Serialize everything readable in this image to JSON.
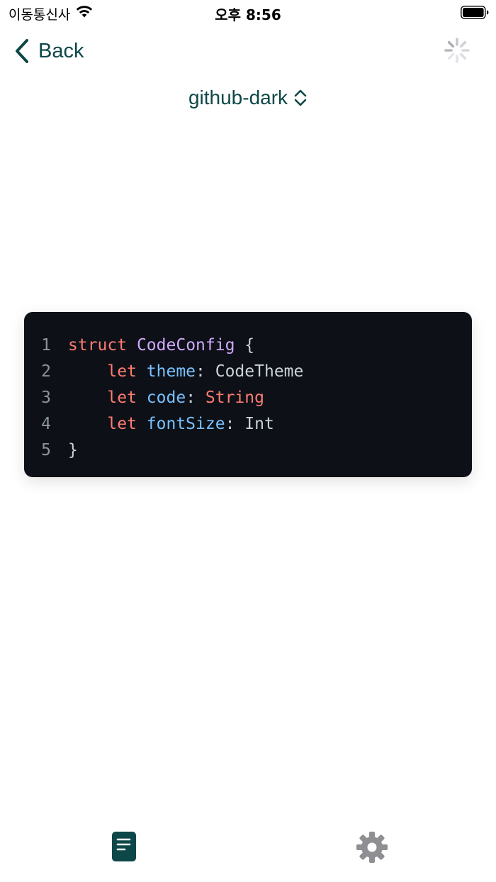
{
  "status_bar": {
    "carrier": "이동통신사",
    "time": "오후 8:56",
    "wifi_icon": "wifi-icon",
    "battery_icon": "battery-icon"
  },
  "nav": {
    "back_label": "Back",
    "back_icon": "chevron-left-icon",
    "spinner_icon": "activity-spinner-icon"
  },
  "theme_selector": {
    "label": "github-dark",
    "icon": "chevron-up-down-icon"
  },
  "code": {
    "lines": [
      {
        "number": "1",
        "tokens": [
          {
            "t": "struct",
            "k": "kw"
          },
          {
            "t": " ",
            "k": "plain"
          },
          {
            "t": "CodeConfig",
            "k": "type"
          },
          {
            "t": " {",
            "k": "plain"
          }
        ]
      },
      {
        "number": "2",
        "tokens": [
          {
            "t": "    ",
            "k": "plain"
          },
          {
            "t": "let",
            "k": "kw"
          },
          {
            "t": " ",
            "k": "plain"
          },
          {
            "t": "theme",
            "k": "prop"
          },
          {
            "t": ": CodeTheme",
            "k": "plain"
          }
        ]
      },
      {
        "number": "3",
        "tokens": [
          {
            "t": "    ",
            "k": "plain"
          },
          {
            "t": "let",
            "k": "kw"
          },
          {
            "t": " ",
            "k": "plain"
          },
          {
            "t": "code",
            "k": "prop"
          },
          {
            "t": ": ",
            "k": "plain"
          },
          {
            "t": "String",
            "k": "kw"
          }
        ]
      },
      {
        "number": "4",
        "tokens": [
          {
            "t": "    ",
            "k": "plain"
          },
          {
            "t": "let",
            "k": "kw"
          },
          {
            "t": " ",
            "k": "plain"
          },
          {
            "t": "fontSize",
            "k": "prop"
          },
          {
            "t": ": Int",
            "k": "plain"
          }
        ]
      },
      {
        "number": "5",
        "tokens": [
          {
            "t": "}",
            "k": "plain"
          }
        ]
      }
    ]
  },
  "tab_bar": {
    "tabs": [
      {
        "icon": "document-icon",
        "selected": true
      },
      {
        "icon": "gear-icon",
        "selected": false
      }
    ]
  },
  "colors": {
    "accent": "#0e4747",
    "code_background": "#0d1117",
    "keyword": "#ff7b72",
    "type": "#d2a8ff",
    "property": "#79c0ff",
    "plain": "#c9d1d9",
    "line_number": "#8b949e",
    "inactive_tab": "#8e8e93"
  }
}
